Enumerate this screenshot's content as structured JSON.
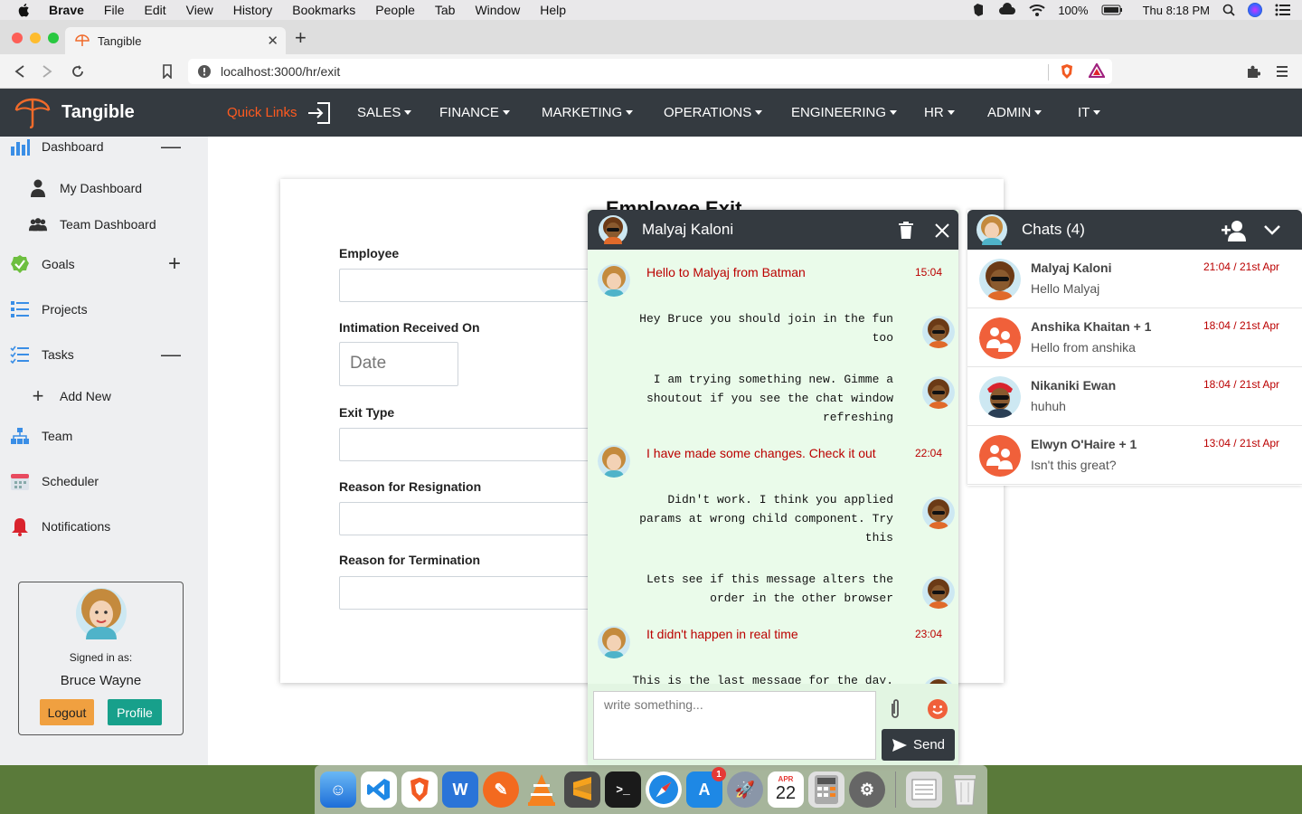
{
  "mac_menu": {
    "app": "Brave",
    "items": [
      "File",
      "Edit",
      "View",
      "History",
      "Bookmarks",
      "People",
      "Tab",
      "Window",
      "Help"
    ],
    "battery": "100%",
    "clock": "Thu 8:18 PM"
  },
  "browser": {
    "tab_title": "Tangible",
    "url": "localhost:3000/hr/exit"
  },
  "navbar": {
    "brand": "Tangible",
    "quick_links": "Quick Links",
    "menus": [
      "SALES",
      "FINANCE",
      "MARKETING",
      "OPERATIONS",
      "ENGINEERING",
      "HR",
      "ADMIN",
      "IT"
    ]
  },
  "sidebar": {
    "dashboard": "Dashboard",
    "my_dashboard": "My Dashboard",
    "team_dashboard": "Team Dashboard",
    "goals": "Goals",
    "projects": "Projects",
    "tasks": "Tasks",
    "add_new": "Add New",
    "team": "Team",
    "scheduler": "Scheduler",
    "notifications": "Notifications",
    "signed_in_as": "Signed in as:",
    "user_name": "Bruce Wayne",
    "logout": "Logout",
    "profile": "Profile"
  },
  "form": {
    "title": "Employee Exit",
    "employee": "Employee",
    "intimation": "Intimation Received On",
    "date_placeholder": "Date",
    "exit_type": "Exit Type",
    "reason_resignation": "Reason for Resignation",
    "reason_termination": "Reason for Termination"
  },
  "chat_window": {
    "contact": "Malyaj Kaloni",
    "messages": [
      {
        "text": "Hello to Malyaj from Batman",
        "time": "15:04"
      },
      {
        "text": "Hey Bruce you should join in the fun too"
      },
      {
        "text": "I am trying something new. Gimme a shoutout if you see the chat window refreshing"
      },
      {
        "text": "I have made some changes. Check it out",
        "time": "22:04"
      },
      {
        "text": "Didn't work. I think you applied params at wrong child component. Try this"
      },
      {
        "text": "Lets see if this message alters the order in the other browser"
      },
      {
        "text": "It didn't happen in real time",
        "time": "23:04"
      },
      {
        "text": "This is the last message for the day."
      }
    ],
    "input_placeholder": "write something...",
    "send": "Send"
  },
  "chats_panel": {
    "title": "Chats (4)",
    "items": [
      {
        "name": "Malyaj Kaloni",
        "time": "21:04 / 21st Apr",
        "message": "Hello Malyaj"
      },
      {
        "name": "Anshika Khaitan + 1",
        "time": "18:04 / 21st Apr",
        "message": "Hello from anshika"
      },
      {
        "name": "Nikaniki Ewan",
        "time": "18:04 / 21st Apr",
        "message": "huhuh"
      },
      {
        "name": "Elwyn O'Haire + 1",
        "time": "13:04 / 21st Apr",
        "message": "Isn't this great?"
      }
    ]
  },
  "dock": {
    "calendar_month": "APR",
    "calendar_day": "22",
    "appstore_badge": "1"
  },
  "colors": {
    "navbar": "#343a40",
    "accent_orange": "#ff5a1f",
    "logout": "#f0a040",
    "profile": "#17a08b",
    "chat_bg": "#eafbea",
    "incoming_text": "#bb0000"
  }
}
